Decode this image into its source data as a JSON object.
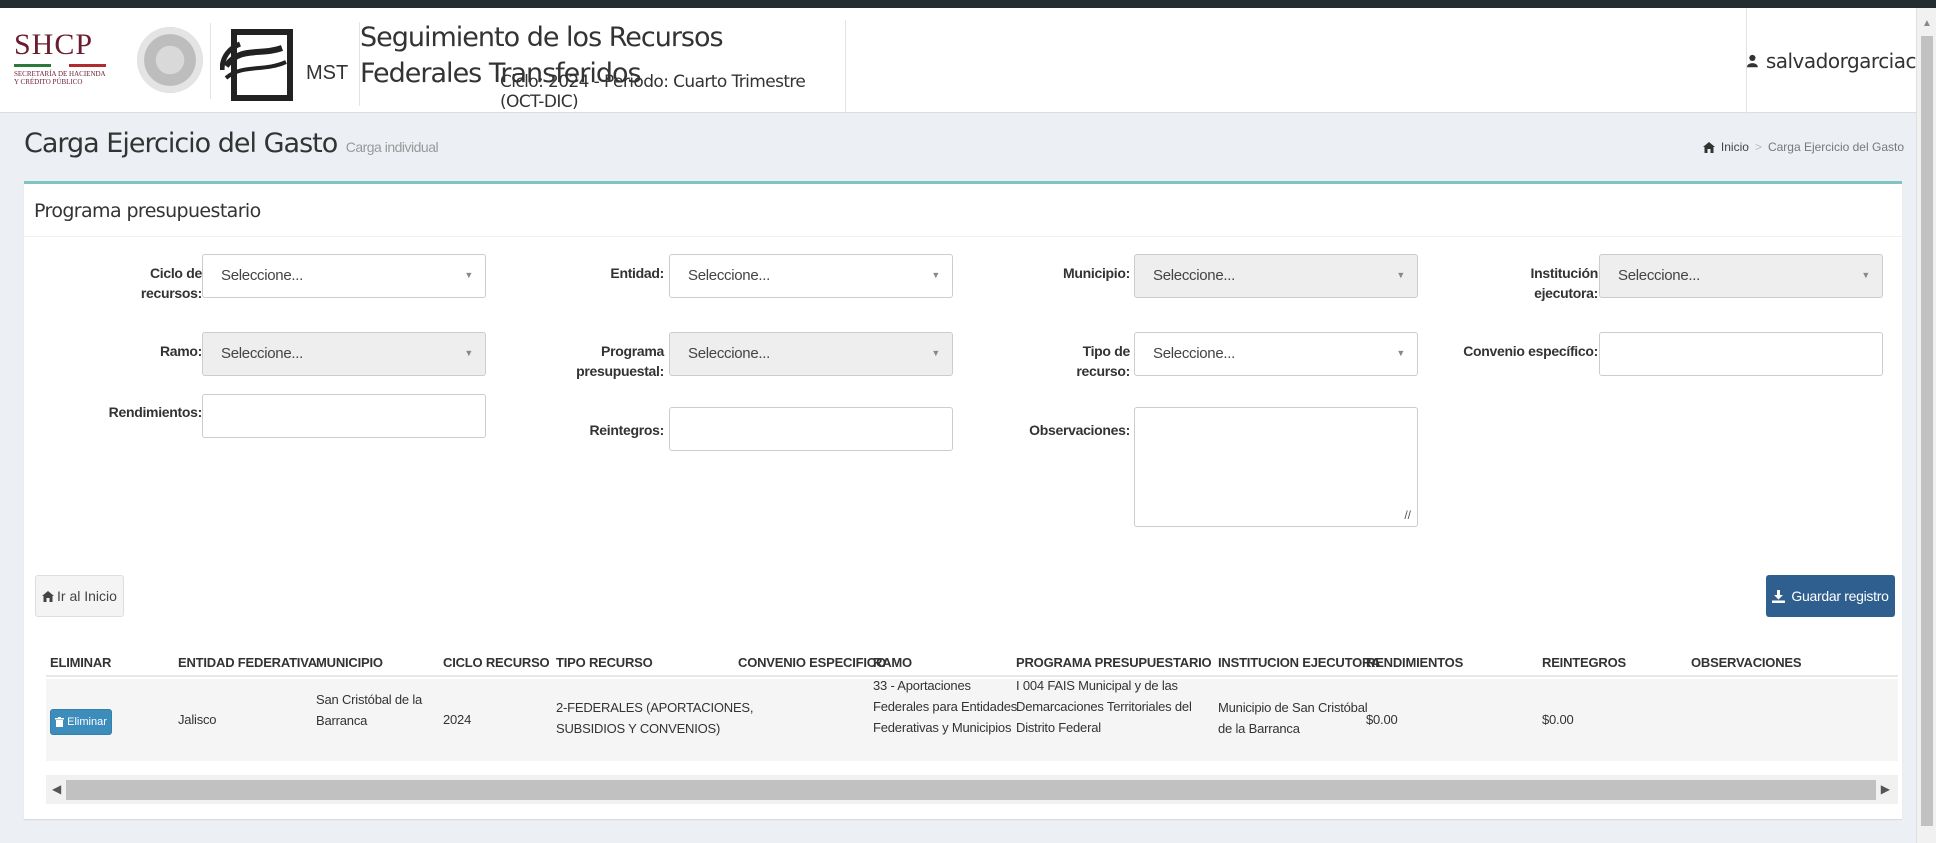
{
  "header": {
    "shcp_logo": "SHCP",
    "shcp_sub_1": "SECRETARÍA DE HACIENDA",
    "shcp_sub_2": "Y CRÉDITO PÚBLICO",
    "mst_logo": "MST",
    "title": "Seguimiento de los Recursos Federales Transferidos",
    "subtitle": "Ciclo: 2024 - Periodo: Cuarto Trimestre (OCT-DIC)",
    "username": "salvadorgarciac"
  },
  "page": {
    "title": "Carga Ejercicio del Gasto",
    "subtitle": "Carga individual",
    "breadcrumb": [
      "Inicio",
      "Carga Ejercicio del Gasto"
    ]
  },
  "box": {
    "title": "Programa presupuestario"
  },
  "form": {
    "ciclo_label_1": "Ciclo de",
    "ciclo_label_2": "recursos:",
    "ciclo_value": "Seleccione...",
    "entidad_label": "Entidad:",
    "entidad_value": "Seleccione...",
    "municipio_label": "Municipio:",
    "municipio_value": "Seleccione...",
    "institucion_label_1": "Institución",
    "institucion_label_2": "ejecutora:",
    "institucion_value": "Seleccione...",
    "ramo_label": "Ramo:",
    "ramo_value": "Seleccione...",
    "programa_label_1": "Programa",
    "programa_label_2": "presupuestal:",
    "programa_value": "Seleccione...",
    "tipo_label_1": "Tipo de",
    "tipo_label_2": "recurso:",
    "tipo_value": "Seleccione...",
    "convenio_label": "Convenio específico:",
    "convenio_value": "",
    "rendimientos_label": "Rendimientos:",
    "rendimientos_value": "",
    "reintegros_label": "Reintegros:",
    "reintegros_value": "",
    "observaciones_label": "Observaciones:",
    "observaciones_value": ""
  },
  "buttons": {
    "home": "Ir al Inicio",
    "save": "Guardar registro",
    "delete": "Eliminar"
  },
  "table": {
    "headers": [
      "ELIMINAR",
      "ENTIDAD FEDERATIVA",
      "MUNICIPIO",
      "CICLO RECURSO",
      "TIPO RECURSO",
      "CONVENIO ESPECIFICO",
      "RAMO",
      "PROGRAMA PRESUPUESTARIO",
      "INSTITUCION EJECUTORA",
      "RENDIMIENTOS",
      "REINTEGROS",
      "OBSERVACIONES"
    ],
    "row": {
      "entidad": "Jalisco",
      "municipio_1": "San Cristóbal de la",
      "municipio_2": "Barranca",
      "ciclo": "2024",
      "tipo_1": "2-FEDERALES (APORTACIONES,",
      "tipo_2": "SUBSIDIOS Y CONVENIOS)",
      "convenio": "",
      "ramo_1": "33 - Aportaciones",
      "ramo_2": "Federales para Entidades",
      "ramo_3": "Federativas y Municipios",
      "programa_1": "I 004 FAIS Municipal y de las",
      "programa_2": "Demarcaciones Territoriales del",
      "programa_3": "Distrito Federal",
      "institucion_1": "Municipio de San Cristóbal",
      "institucion_2": "de la Barranca",
      "rendimientos": "$0.00",
      "reintegros": "$0.00",
      "observaciones": ""
    }
  }
}
